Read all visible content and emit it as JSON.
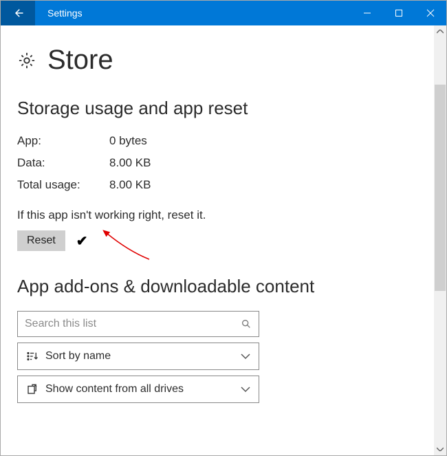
{
  "titlebar": {
    "title": "Settings"
  },
  "page": {
    "title": "Store"
  },
  "sections": {
    "storage": {
      "heading": "Storage usage and app reset",
      "app_label": "App:",
      "app_value": "0 bytes",
      "data_label": "Data:",
      "data_value": "8.00 KB",
      "total_label": "Total usage:",
      "total_value": "8.00 KB",
      "hint": "If this app isn't working right, reset it.",
      "reset_label": "Reset"
    },
    "addons": {
      "heading": "App add-ons & downloadable content",
      "search_placeholder": "Search this list",
      "sort_label": "Sort by name",
      "drives_label": "Show content from all drives"
    }
  }
}
